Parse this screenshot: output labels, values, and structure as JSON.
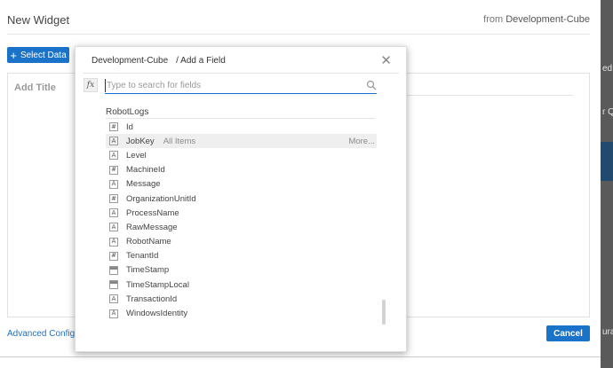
{
  "widget": {
    "title": "New Widget",
    "from_prefix": "from",
    "from_source": "Development-Cube",
    "select_data_label": "Select Data",
    "add_title_placeholder": "Add Title",
    "advanced_link": "Advanced Configurati",
    "cancel_label": "Cancel"
  },
  "background_fragments": {
    "frag1": "ed",
    "frag2": "r Qu",
    "frag3": "urati"
  },
  "modal": {
    "cube": "Development-Cube",
    "title": "/ Add a Field",
    "fx_label": "fx",
    "search_placeholder": "Type to search for fields",
    "group": "RobotLogs",
    "fields": [
      {
        "name": "Id",
        "type": "number",
        "icon": "#"
      },
      {
        "name": "JobKey",
        "type": "text",
        "icon": "A",
        "sub": "All Items",
        "more": "More..."
      },
      {
        "name": "Level",
        "type": "text",
        "icon": "A"
      },
      {
        "name": "MachineId",
        "type": "number",
        "icon": "#"
      },
      {
        "name": "Message",
        "type": "text",
        "icon": "A"
      },
      {
        "name": "OrganizationUnitId",
        "type": "number",
        "icon": "#"
      },
      {
        "name": "ProcessName",
        "type": "text",
        "icon": "A"
      },
      {
        "name": "RawMessage",
        "type": "text",
        "icon": "A"
      },
      {
        "name": "RobotName",
        "type": "text",
        "icon": "A"
      },
      {
        "name": "TenantId",
        "type": "number",
        "icon": "#"
      },
      {
        "name": "TimeStamp",
        "type": "date",
        "icon": ""
      },
      {
        "name": "TimeStampLocal",
        "type": "date",
        "icon": ""
      },
      {
        "name": "TransactionId",
        "type": "text",
        "icon": "A"
      },
      {
        "name": "WindowsIdentity",
        "type": "text",
        "icon": "A"
      }
    ]
  },
  "colors": {
    "accent": "#1a73c8",
    "overlay": "#5a5a5a"
  }
}
